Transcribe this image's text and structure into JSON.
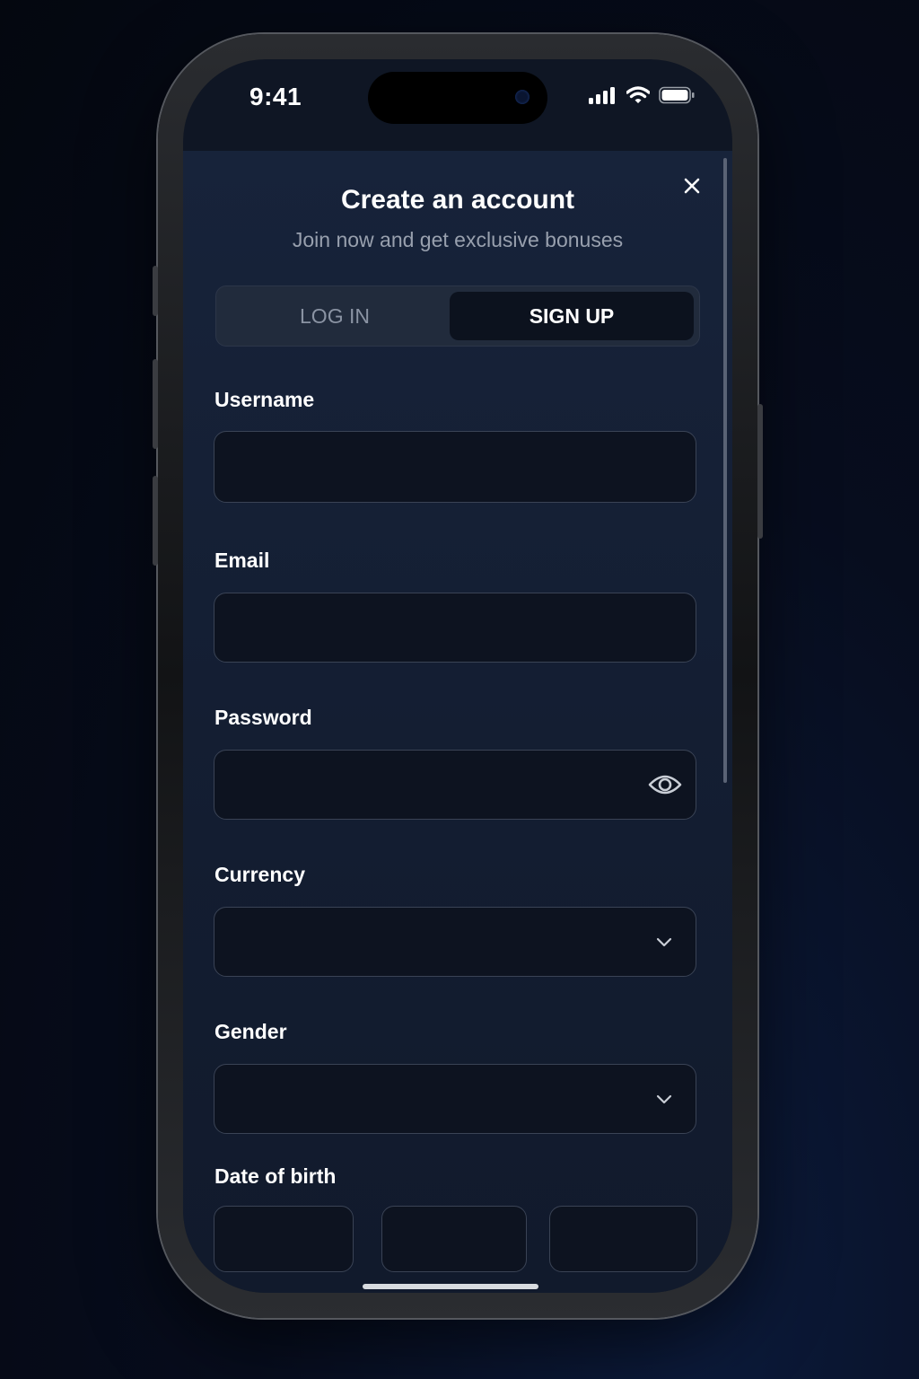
{
  "status_bar": {
    "time": "9:41",
    "icons": [
      "signal-icon",
      "wifi-icon",
      "battery-icon"
    ]
  },
  "modal": {
    "title": "Create an account",
    "subtitle": "Join now and get exclusive bonuses",
    "close_icon": "close-icon"
  },
  "tabs": [
    {
      "label": "LOG IN",
      "active": false
    },
    {
      "label": "SIGN UP",
      "active": true
    }
  ],
  "form": {
    "username": {
      "label": "Username",
      "value": ""
    },
    "email": {
      "label": "Email",
      "value": ""
    },
    "password": {
      "label": "Password",
      "value": "",
      "icon": "eye-icon"
    },
    "currency": {
      "label": "Currency",
      "value": "",
      "icon": "chevron-down-icon"
    },
    "gender": {
      "label": "Gender",
      "value": "",
      "icon": "chevron-down-icon"
    },
    "date_of_birth": {
      "label": "Date of birth",
      "day": "",
      "month": "",
      "year": ""
    }
  },
  "colors": {
    "background": "#070d1e",
    "sheet": "#17233a",
    "input_bg": "#0d1320",
    "input_border": "#3a4355",
    "text_primary": "#ffffff",
    "text_muted": "#98a0ae"
  }
}
